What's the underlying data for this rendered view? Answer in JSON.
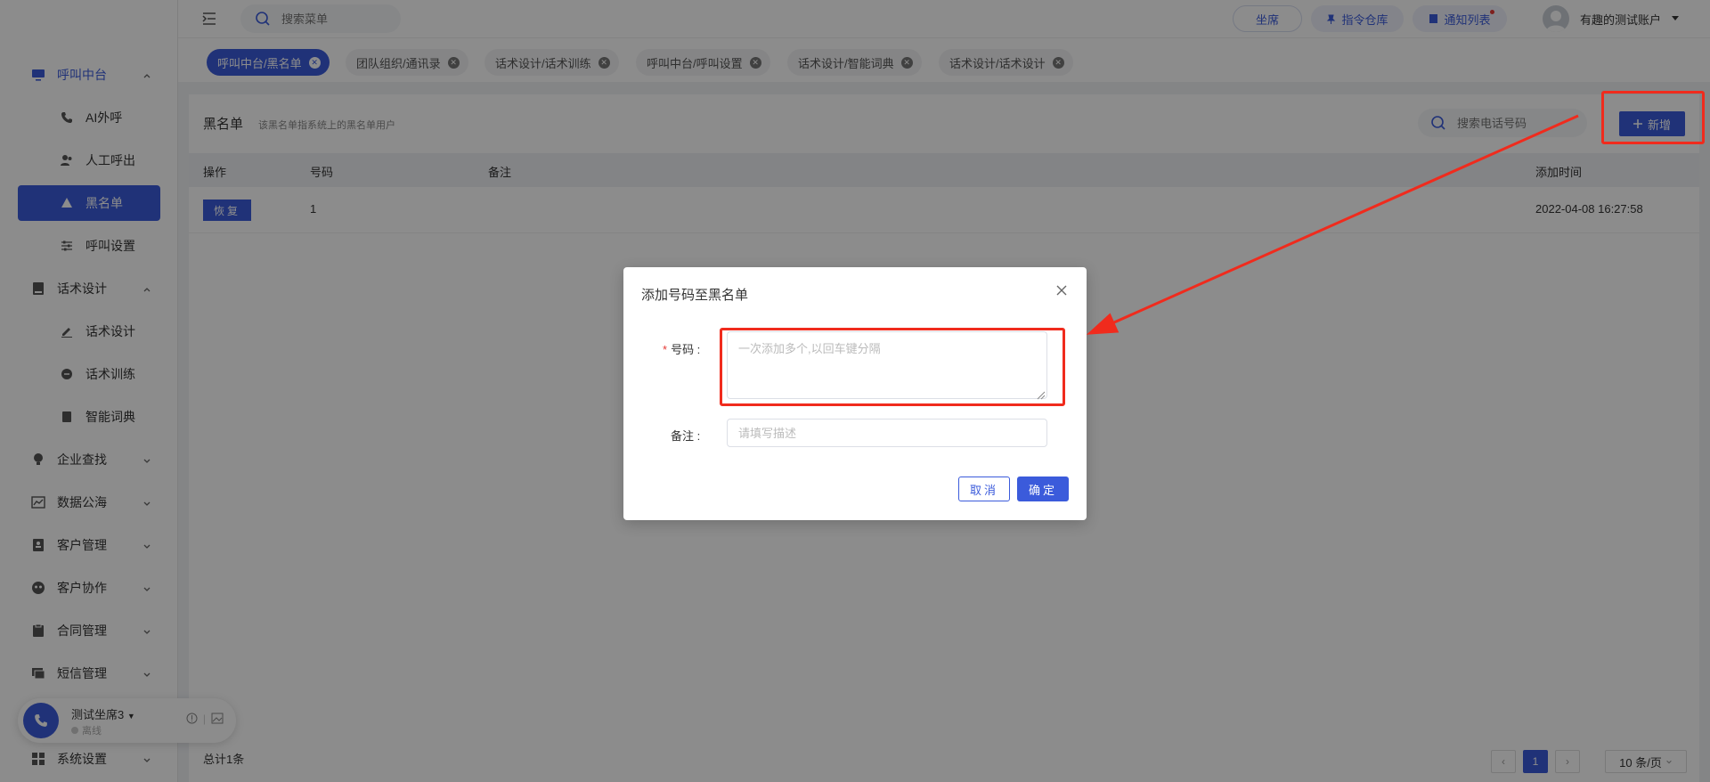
{
  "sidebar": {
    "items": [
      {
        "label": "呼叫中台",
        "icon": "monitor-icon",
        "arrow": "up"
      },
      {
        "label": "AI外呼",
        "icon": "phone-icon"
      },
      {
        "label": "人工呼出",
        "icon": "users-icon"
      },
      {
        "label": "黑名单",
        "icon": "warning-icon"
      },
      {
        "label": "呼叫设置",
        "icon": "sliders-icon"
      },
      {
        "label": "话术设计",
        "icon": "book-icon",
        "arrow": "up"
      },
      {
        "label": "话术设计",
        "icon": "pen-icon"
      },
      {
        "label": "话术训练",
        "icon": "chat-icon"
      },
      {
        "label": "智能词典",
        "icon": "dictionary-icon"
      },
      {
        "label": "企业查找",
        "icon": "bulb-icon",
        "arrow": "down"
      },
      {
        "label": "数据公海",
        "icon": "chart-icon",
        "arrow": "down"
      },
      {
        "label": "客户管理",
        "icon": "contacts-icon",
        "arrow": "down"
      },
      {
        "label": "客户协作",
        "icon": "team-icon",
        "arrow": "down"
      },
      {
        "label": "合同管理",
        "icon": "clipboard-icon",
        "arrow": "down"
      },
      {
        "label": "短信管理",
        "icon": "message-icon",
        "arrow": "down"
      },
      {
        "label": "系统设置",
        "icon": "grid-icon",
        "arrow": "down"
      }
    ],
    "agent": {
      "name": "测试坐席3",
      "status": "离线"
    }
  },
  "header": {
    "search_placeholder": "搜索菜单",
    "seat_label": "坐席",
    "command_label": "指令仓库",
    "notify_label": "通知列表",
    "user_name": "有趣的测试账户"
  },
  "tabs": [
    {
      "label": "呼叫中台/黑名单",
      "active": true
    },
    {
      "label": "团队组织/通讯录"
    },
    {
      "label": "话术设计/话术训练"
    },
    {
      "label": "呼叫中台/呼叫设置"
    },
    {
      "label": "话术设计/智能词典"
    },
    {
      "label": "话术设计/话术设计"
    }
  ],
  "content": {
    "title": "黑名单",
    "description": "该黑名单指系统上的黑名单用户",
    "search_placeholder": "搜索电话号码",
    "add_label": "新增",
    "columns": [
      "操作",
      "号码",
      "备注",
      "添加时间"
    ],
    "rows": [
      {
        "action": "恢复",
        "number": "1",
        "remark": "",
        "added_at": "2022-04-08 16:27:58"
      }
    ],
    "total": "总计1条",
    "current_page": "1",
    "page_size": "10 条/页"
  },
  "modal": {
    "title": "添加号码至黑名单",
    "number_label": "号码 :",
    "number_placeholder": "一次添加多个,以回车键分隔",
    "note_label": "备注 :",
    "note_placeholder": "请填写描述",
    "cancel_label": "取消",
    "ok_label": "确定"
  },
  "colors": {
    "accent": "#3b5bdb",
    "annotation": "#f02b1d",
    "required": "#e53935"
  }
}
